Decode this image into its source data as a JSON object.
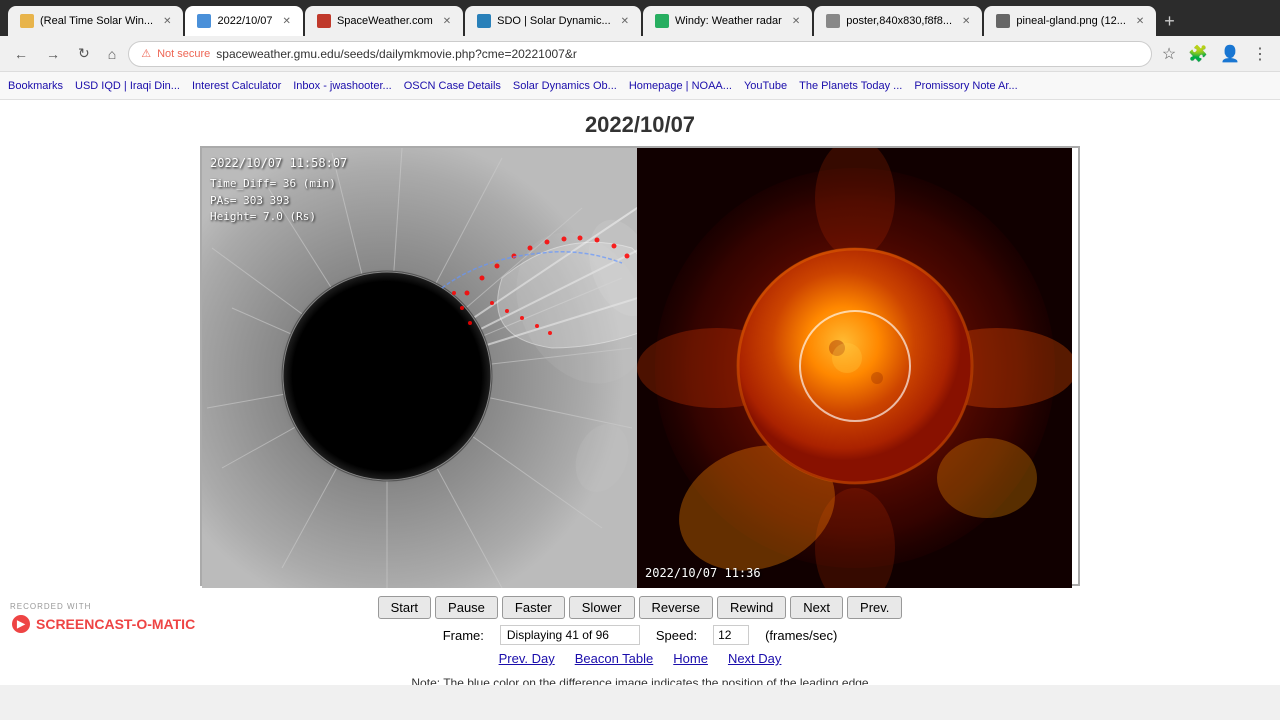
{
  "browser": {
    "tabs": [
      {
        "id": "tab1",
        "label": "(Real Time Solar Win...",
        "favicon_color": "#e8b44b",
        "active": false
      },
      {
        "id": "tab2",
        "label": "2022/10/07",
        "favicon_color": "#4a90d9",
        "active": true
      },
      {
        "id": "tab3",
        "label": "SpaceWeather.com",
        "favicon_color": "#c0392b",
        "active": false
      },
      {
        "id": "tab4",
        "label": "SDO | Solar Dynamic...",
        "favicon_color": "#2980b9",
        "active": false
      },
      {
        "id": "tab5",
        "label": "Windy: Weather radar",
        "favicon_color": "#27ae60",
        "active": false
      },
      {
        "id": "tab6",
        "label": "poster,840x830,f8f8...",
        "favicon_color": "#888",
        "active": false
      },
      {
        "id": "tab7",
        "label": "pineal-gland.png (12...",
        "favicon_color": "#666",
        "active": false
      }
    ],
    "address": "spaceweather.gmu.edu/seeds/dailymkmovie.php?cme=20221007&r",
    "security_label": "Not secure"
  },
  "bookmarks": [
    "Bookmarks",
    "USD IQD | Iraqi Din...",
    "Interest Calculator",
    "Inbox - jwashooter...",
    "OSCN Case Details",
    "Solar Dynamics Ob...",
    "Homepage | NOAA...",
    "YouTube",
    "The Planets Today ...",
    "Promissory Note Ar..."
  ],
  "page": {
    "title": "2022/10/07",
    "lasco": {
      "timestamp": "2022/10/07  11:58:07",
      "time_diff": "Time_Diff= 36 (min)",
      "pas": "PAs=  303 393",
      "height": "Height=  7.0 (Rs)",
      "bottom_timestamp": ""
    },
    "aia": {
      "timestamp": "2022/10/07 11:36"
    },
    "controls": {
      "start": "Start",
      "pause": "Pause",
      "faster": "Faster",
      "slower": "Slower",
      "reverse": "Reverse",
      "rewind": "Rewind",
      "next": "Next",
      "prev": "Prev.",
      "frame_label": "Frame:",
      "frame_value": "Displaying 41 of 96",
      "speed_label": "Speed:",
      "speed_value": "12",
      "fps_label": "(frames/sec)"
    },
    "links": {
      "prev_day": "Prev. Day",
      "beacon_table": "Beacon Table",
      "home": "Home",
      "next_day": "Next Day"
    },
    "note": "Note: The blue color on the difference image indicates the position of the leading edge"
  },
  "watermark": {
    "recorded_label": "RECORDED WITH",
    "brand": "SCREENCAST-O-MATIC"
  }
}
